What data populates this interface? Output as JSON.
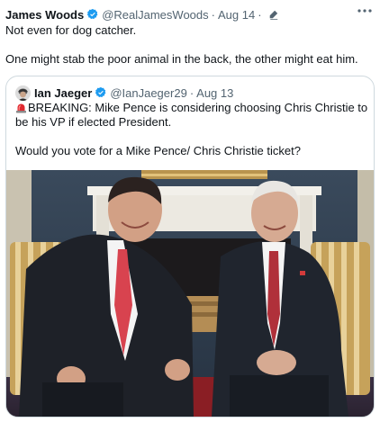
{
  "tweet": {
    "author_name": "James Woods",
    "author_handle": "@RealJamesWoods",
    "date": "Aug 14",
    "line1": "Not even for dog catcher.",
    "line2": "One might stab the poor animal in the back, the other might eat him."
  },
  "quote": {
    "author_name": "Ian Jaeger",
    "author_handle": "@IanJaeger29",
    "date": "Aug 13",
    "breaking_text": "BREAKING: Mike Pence is considering choosing Chris Christie to be his VP if elected President.",
    "question": "Would you vote for a Mike Pence/ Chris Christie ticket?"
  },
  "icons": {
    "verified": "verified-badge-icon",
    "edit": "edit-pencil-icon",
    "more": "more-dots-icon",
    "siren": "siren-emoji-icon"
  },
  "colors": {
    "verified_blue": "#1d9bf0",
    "secondary_text": "#536471",
    "border": "#cfd9de"
  }
}
